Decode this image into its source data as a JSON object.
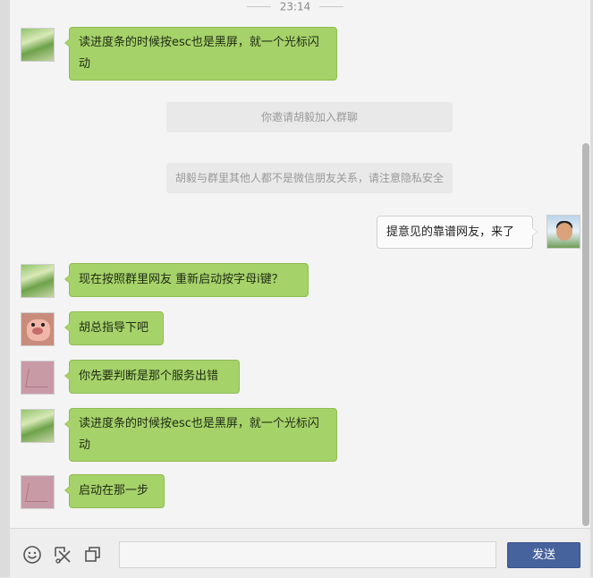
{
  "timestamp": "23:14",
  "messages": [
    {
      "text": "读进度条的时候按esc也是黑屏，就一个光标闪动"
    },
    {
      "text": "提意见的靠谱网友，来了"
    },
    {
      "text": "现在按照群里网友 重新启动按字母i键？"
    },
    {
      "text": "胡总指导下吧"
    },
    {
      "text": "你先要判断是那个服务出错"
    },
    {
      "text": "读进度条的时候按esc也是黑屏，就一个光标闪动"
    },
    {
      "text": "启动在那一步"
    }
  ],
  "system_notices": [
    "你邀请胡毅加入群聊",
    "胡毅与群里其他人都不是微信朋友关系，请注意隐私安全"
  ],
  "footer": {
    "icons": [
      "smiley-icon",
      "scissors-icon",
      "copy-icon"
    ],
    "send_label": "发送"
  },
  "colors": {
    "incoming_bubble": "#a6d26a",
    "outgoing_bubble": "#fbfbfb",
    "send_button": "#47639e"
  }
}
